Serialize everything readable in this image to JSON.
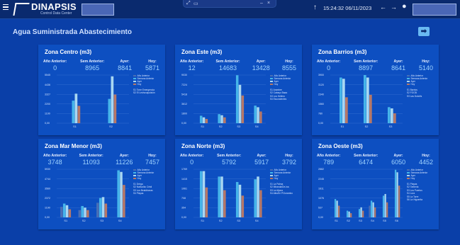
{
  "app": {
    "logo": "DINAPSIS",
    "logo_sub": "Control Data Center",
    "datetime": "15:24:32 06/11/2023"
  },
  "header": {
    "title": "Agua Suministrada Abastecimiento"
  },
  "colors": {
    "background": "#0a3fa8",
    "card": "#0d4fc1",
    "anio_anterior": "#4a6fb5",
    "semana_anterior": "#46b5ea",
    "ayer": "#a8d7f2",
    "hoy": "#b67868"
  },
  "cards": [
    {
      "title": "Zona Centro (m3)",
      "stats": [
        {
          "label": "Año Anterior:",
          "value": "0"
        },
        {
          "label": "Sem Anterior:",
          "value": "8965"
        },
        {
          "label": "Ayer:",
          "value": "8841"
        },
        {
          "label": "Hoy:",
          "value": "5871"
        }
      ],
      "y_ticks": [
        "0,00",
        "1100",
        "2200",
        "3327",
        "4436",
        "5545"
      ],
      "y_max": 5545,
      "x_ticks": [
        "S1",
        "S2"
      ],
      "legend_names": [
        "S1  Torre Emergencia",
        "S2  El Lechusquuisión"
      ]
    },
    {
      "title": "Zona Este (m3)",
      "stats": [
        {
          "label": "Año Anterior:",
          "value": "12"
        },
        {
          "label": "Sem Anterior:",
          "value": "14683"
        },
        {
          "label": "Ayer:",
          "value": "13428"
        },
        {
          "label": "Hoy:",
          "value": "8555"
        }
      ],
      "y_ticks": [
        "0,00",
        "1800",
        "3612",
        "5418",
        "7224",
        "9030"
      ],
      "y_max": 9030,
      "x_ticks": [
        "S1",
        "S2",
        "S3",
        "S4"
      ],
      "legend_names": [
        "S1  Arambre",
        "S2  Cabaço Baaa",
        "S3  Los Hellero",
        "S4  Escondentes"
      ]
    },
    {
      "title": "Zona Barrios (m3)",
      "stats": [
        {
          "label": "Año Anterior:",
          "value": "0"
        },
        {
          "label": "Sem Anterior:",
          "value": "8897"
        },
        {
          "label": "Ayer:",
          "value": "8641"
        },
        {
          "label": "Hoy:",
          "value": "5140"
        }
      ],
      "y_ticks": [
        "0,00",
        "780",
        "1560",
        "2340",
        "3120",
        "3900"
      ],
      "y_max": 3900,
      "x_ticks": [
        "S1",
        "S2",
        "S3"
      ],
      "legend_names": [
        "S1  Barrios",
        "S2  FOGB",
        "S3  Las Dolcéls"
      ]
    },
    {
      "title": "Zona Mar Menor (m3)",
      "stats": [
        {
          "label": "Año Anterior:",
          "value": "3748"
        },
        {
          "label": "Sem Anterior:",
          "value": "11093"
        },
        {
          "label": "Ayer:",
          "value": "11226"
        },
        {
          "label": "Hoy:",
          "value": "7457"
        }
      ],
      "y_ticks": [
        "0,00",
        "1190",
        "2372",
        "3560",
        "4744",
        "5930"
      ],
      "y_max": 5930,
      "x_ticks": [
        "S1",
        "S2",
        "S3",
        "S4"
      ],
      "legend_names": [
        "S1  Dréga",
        "S2  Nabuciko Cristi",
        "S3  Los Bealdbonas",
        "S4  Playas"
      ]
    },
    {
      "title": "Zona Norte (m3)",
      "stats": [
        {
          "label": "Año Anterior:",
          "value": "0"
        },
        {
          "label": "Sem Anterior:",
          "value": "5792"
        },
        {
          "label": "Ayer:",
          "value": "5917"
        },
        {
          "label": "Hoy:",
          "value": "3792"
        }
      ],
      "y_ticks": [
        "0,00",
        "354",
        "708",
        "1061",
        "1415",
        "1769"
      ],
      "y_max": 1769,
      "x_ticks": [
        "S1",
        "S2",
        "S3",
        "S4"
      ],
      "legend_names": [
        "S1  La Palma",
        "S2  Miranda/De-ina",
        "S3  La Aljona",
        "S4  AlbuErí PClurambo"
      ]
    },
    {
      "title": "Zona Oeste (m3)",
      "stats": [
        {
          "label": "Año Anterior:",
          "value": "789"
        },
        {
          "label": "Sem Anterior:",
          "value": "6474"
        },
        {
          "label": "Ayer:",
          "value": "6050"
        },
        {
          "label": "Hoy:",
          "value": "4452"
        }
      ],
      "y_ticks": [
        "0,00",
        "537",
        "1076",
        "1611",
        "2245",
        "2882"
      ],
      "y_max": 2882,
      "x_ticks": [
        "S1",
        "S2",
        "S3",
        "S4",
        "S5",
        "S6"
      ],
      "legend_names": [
        "S1  Playas",
        "S2  Tarbería",
        "S3  Los Puertos",
        "S4  Lora",
        "S5  La Torre",
        "S6  La Higuerita"
      ]
    }
  ],
  "legend_labels": [
    "Año Anterior",
    "Semana Anterior",
    "Ayer",
    "Hoy"
  ],
  "chart_data": [
    {
      "type": "bar",
      "title": "Zona Centro (m3)",
      "categories": [
        "S1",
        "S2"
      ],
      "series": [
        {
          "name": "Año Anterior",
          "values": [
            0,
            0
          ]
        },
        {
          "name": "Semana Anterior",
          "values": [
            2600,
            2800
          ]
        },
        {
          "name": "Ayer",
          "values": [
            3400,
            5400
          ]
        },
        {
          "name": "Hoy",
          "values": [
            2000,
            3300
          ]
        }
      ],
      "ylim": [
        0,
        5545
      ]
    },
    {
      "type": "bar",
      "title": "Zona Este (m3)",
      "categories": [
        "S1",
        "S2",
        "S3",
        "S4"
      ],
      "series": [
        {
          "name": "Año Anterior",
          "values": [
            0,
            0,
            0,
            0
          ]
        },
        {
          "name": "Semana Anterior",
          "values": [
            1400,
            1700,
            9000,
            3300
          ]
        },
        {
          "name": "Ayer",
          "values": [
            1100,
            1500,
            7200,
            3000
          ]
        },
        {
          "name": "Hoy",
          "values": [
            800,
            1100,
            5200,
            2200
          ]
        }
      ],
      "ylim": [
        0,
        9030
      ]
    },
    {
      "type": "bar",
      "title": "Zona Barrios (m3)",
      "categories": [
        "S1",
        "S2",
        "S3"
      ],
      "series": [
        {
          "name": "Año Anterior",
          "values": [
            0,
            0,
            0
          ]
        },
        {
          "name": "Semana Anterior",
          "values": [
            3700,
            3900,
            1300
          ]
        },
        {
          "name": "Ayer",
          "values": [
            3600,
            3700,
            1200
          ]
        },
        {
          "name": "Hoy",
          "values": [
            2100,
            2300,
            800
          ]
        }
      ],
      "ylim": [
        0,
        3900
      ]
    },
    {
      "type": "bar",
      "title": "Zona Mar Menor (m3)",
      "categories": [
        "S1",
        "S2",
        "S3",
        "S4"
      ],
      "series": [
        {
          "name": "Año Anterior",
          "values": [
            1300,
            900,
            1800,
            0
          ]
        },
        {
          "name": "Semana Anterior",
          "values": [
            1700,
            1400,
            2400,
            5800
          ]
        },
        {
          "name": "Ayer",
          "values": [
            1500,
            1200,
            2500,
            5600
          ]
        },
        {
          "name": "Hoy",
          "values": [
            1000,
            900,
            1700,
            4000
          ]
        }
      ],
      "ylim": [
        0,
        5930
      ]
    },
    {
      "type": "bar",
      "title": "Zona Norte (m3)",
      "categories": [
        "S1",
        "S2",
        "S3",
        "S4"
      ],
      "series": [
        {
          "name": "Año Anterior",
          "values": [
            0,
            0,
            0,
            0
          ]
        },
        {
          "name": "Semana Anterior",
          "values": [
            1700,
            1500,
            1300,
            1400
          ]
        },
        {
          "name": "Ayer",
          "values": [
            1700,
            1500,
            1200,
            1500
          ]
        },
        {
          "name": "Hoy",
          "values": [
            1100,
            1000,
            800,
            1000
          ]
        }
      ],
      "ylim": [
        0,
        1769
      ]
    },
    {
      "type": "bar",
      "title": "Zona Oeste (m3)",
      "categories": [
        "S1",
        "S2",
        "S3",
        "S4",
        "S5",
        "S6"
      ],
      "series": [
        {
          "name": "Año Anterior",
          "values": [
            0,
            0,
            0,
            700,
            0,
            0
          ]
        },
        {
          "name": "Semana Anterior",
          "values": [
            1100,
            400,
            500,
            1000,
            1300,
            2850
          ]
        },
        {
          "name": "Ayer",
          "values": [
            1000,
            350,
            600,
            900,
            1400,
            2700
          ]
        },
        {
          "name": "Hoy",
          "values": [
            700,
            250,
            400,
            600,
            900,
            1900
          ]
        }
      ],
      "ylim": [
        0,
        2882
      ]
    }
  ]
}
